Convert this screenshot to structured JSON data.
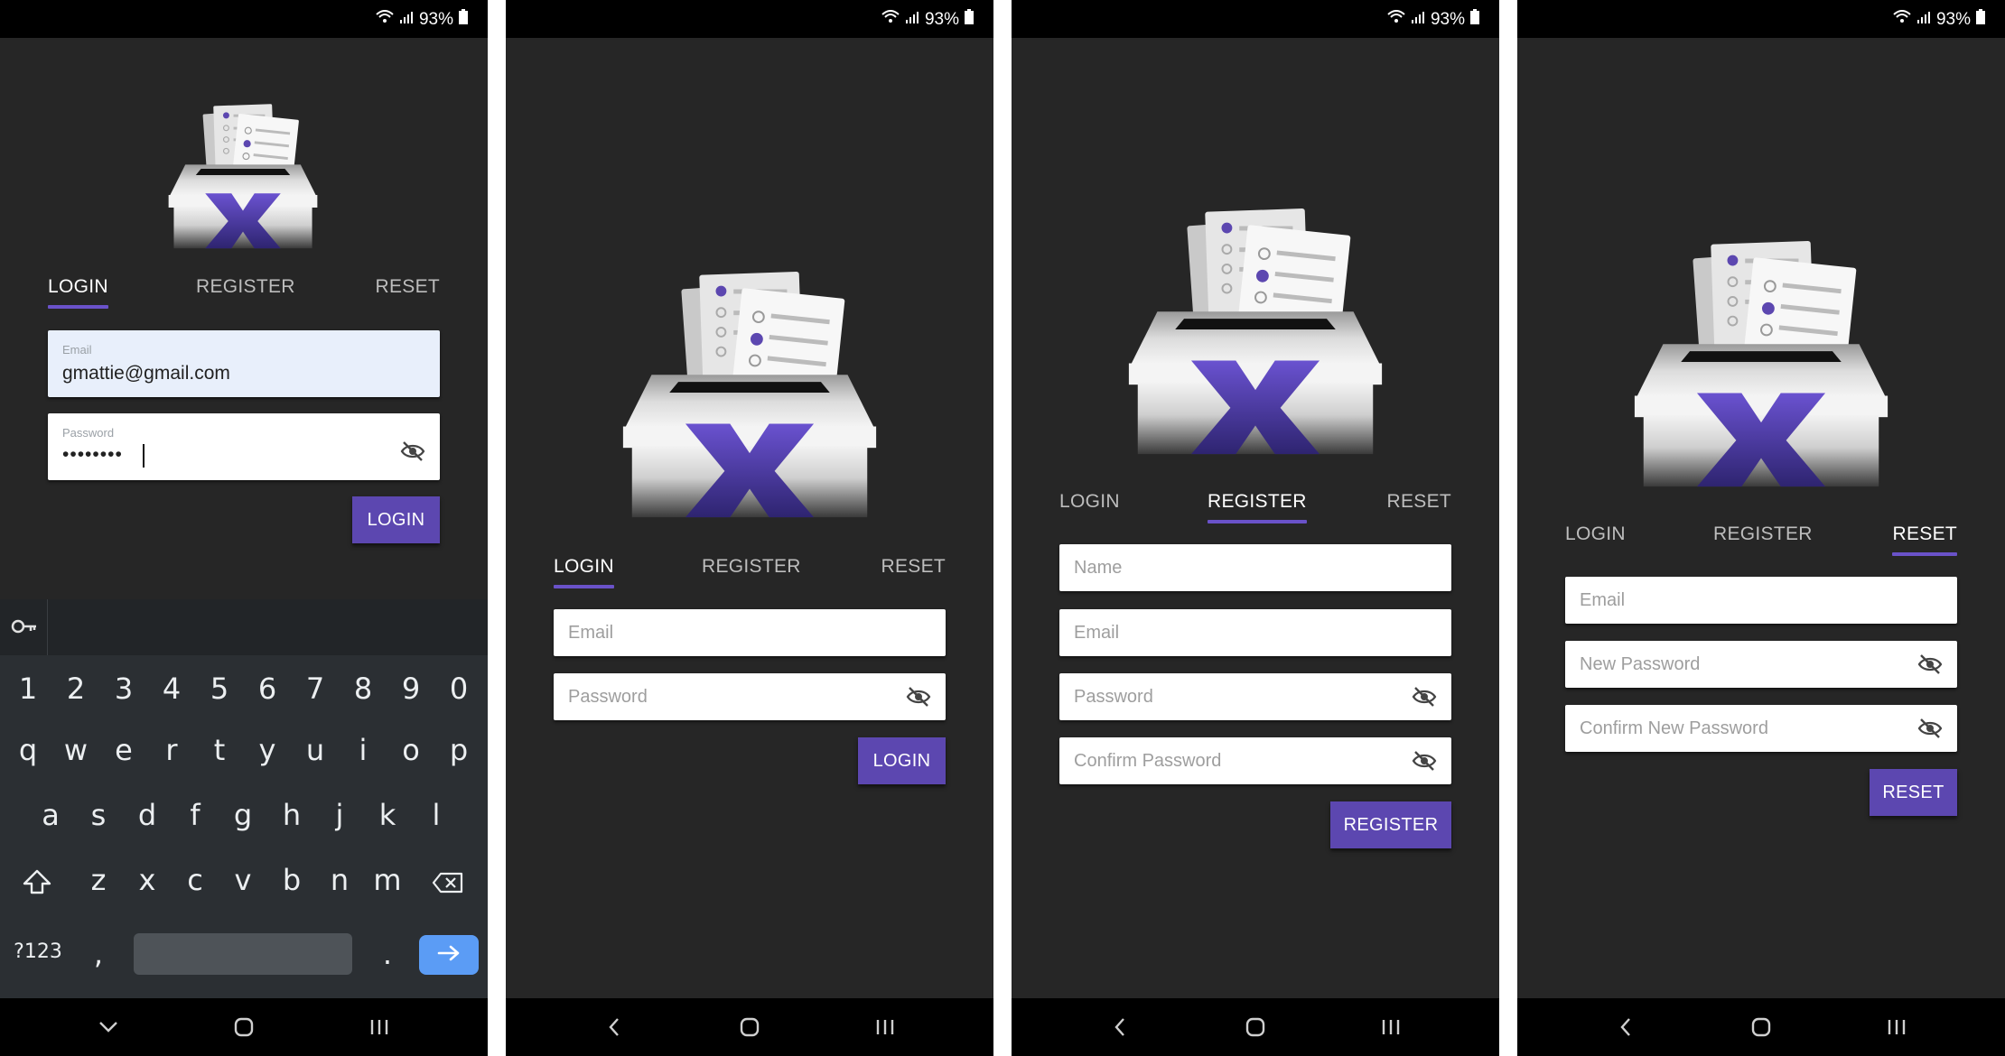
{
  "status": {
    "battery": "93%"
  },
  "keyboard": {
    "row_numbers": [
      "1",
      "2",
      "3",
      "4",
      "5",
      "6",
      "7",
      "8",
      "9",
      "0"
    ],
    "row_top": [
      "q",
      "w",
      "e",
      "r",
      "t",
      "y",
      "u",
      "i",
      "o",
      "p"
    ],
    "row_mid": [
      "a",
      "s",
      "d",
      "f",
      "g",
      "h",
      "j",
      "k",
      "l"
    ],
    "row_bottom": [
      "z",
      "x",
      "c",
      "v",
      "b",
      "n",
      "m"
    ],
    "symbols_label": "?123",
    "comma": ",",
    "period": "."
  },
  "screens": [
    {
      "tabs": [
        "LOGIN",
        "REGISTER",
        "RESET"
      ],
      "active_tab": "LOGIN",
      "fields": [
        {
          "label": "Email",
          "value": "gmattie@gmail.com"
        },
        {
          "label": "Password",
          "value": "••••••••"
        }
      ],
      "button": "LOGIN"
    },
    {
      "tabs": [
        "LOGIN",
        "REGISTER",
        "RESET"
      ],
      "active_tab": "LOGIN",
      "fields": [
        {
          "placeholder": "Email"
        },
        {
          "placeholder": "Password"
        }
      ],
      "button": "LOGIN"
    },
    {
      "tabs": [
        "LOGIN",
        "REGISTER",
        "RESET"
      ],
      "active_tab": "REGISTER",
      "fields": [
        {
          "placeholder": "Name"
        },
        {
          "placeholder": "Email"
        },
        {
          "placeholder": "Password"
        },
        {
          "placeholder": "Confirm Password"
        }
      ],
      "button": "REGISTER"
    },
    {
      "tabs": [
        "LOGIN",
        "REGISTER",
        "RESET"
      ],
      "active_tab": "RESET",
      "fields": [
        {
          "placeholder": "Email"
        },
        {
          "placeholder": "New Password"
        },
        {
          "placeholder": "Confirm New Password"
        }
      ],
      "button": "RESET"
    }
  ],
  "colors": {
    "accent": "#5c47b0",
    "background": "#262626",
    "bar": "#000000",
    "autofill": "#e8effb"
  }
}
